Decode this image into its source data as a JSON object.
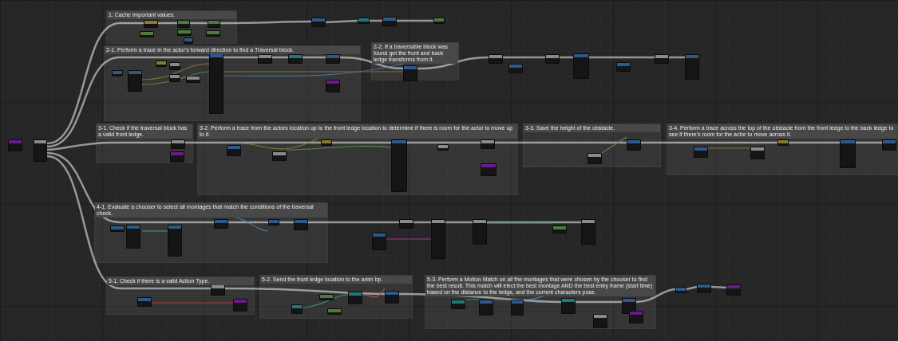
{
  "comments": [
    {
      "title": "1. Cache important values."
    },
    {
      "title": "2-1. Perform a trace in the actor's forward direction to find a Traversal block."
    },
    {
      "title": "2-2. If a traversable block was found get the front and back ledge transforms from it."
    },
    {
      "title": "3-1. Check if the traversal block has a valid front ledge."
    },
    {
      "title": "3-2. Perform a trace from the actors location up to the front ledge location to determine if there is room for the actor to move up to it."
    },
    {
      "title": "3-3. Save the height of the obstacle."
    },
    {
      "title": "3-4. Perform a trace across the top of the obstacle from the front ledge to the back ledge to see if there's room for the actor to move across it."
    },
    {
      "title": "4-1. Evaluate a chooser to select all montages that match the conditions of the traversal check."
    },
    {
      "title": "5-1. Check if there is a valid Action Type."
    },
    {
      "title": "5-2. Send the front ledge location to the anim bp."
    },
    {
      "title": "5-3. Perform a Motion Match on all the montages that were chosen by the chooser to find the best result. This match will elect the best montage AND the best entry frame (start time) based on the distance to the ledge, and the current characters pose."
    }
  ],
  "nodes": [
    {
      "color": "#6a1a8a"
    },
    {
      "color": "#8a8a8a"
    },
    {
      "color": "#8a7a30"
    },
    {
      "color": "#4e7a3c"
    },
    {
      "color": "#4e7a3c"
    },
    {
      "color": "#4e7a3c"
    },
    {
      "color": "#4e7a3c"
    },
    {
      "color": "#4e7a3c"
    },
    {
      "color": "#2d5a8a"
    },
    {
      "color": "#2d5a8a"
    },
    {
      "color": "#1e7a7a"
    },
    {
      "color": "#2d5a8a"
    },
    {
      "color": "#4e7a3c"
    },
    {
      "color": "#2d5a8a"
    },
    {
      "color": "#2d5a8a"
    },
    {
      "color": "#8a7a30"
    },
    {
      "color": "#8a8a8a"
    },
    {
      "color": "#8a8a8a"
    },
    {
      "color": "#8a8a8a"
    },
    {
      "color": "#2d5a8a"
    },
    {
      "color": "#8a8a8a"
    },
    {
      "color": "#1e7a7a"
    },
    {
      "color": "#2d5a8a"
    },
    {
      "color": "#6a1a8a"
    },
    {
      "color": "#2d5a8a"
    },
    {
      "color": "#8a8a8a"
    },
    {
      "color": "#2d5a8a"
    },
    {
      "color": "#8a8a8a"
    },
    {
      "color": "#2d5a8a"
    },
    {
      "color": "#2d5a8a"
    },
    {
      "color": "#8a8a8a"
    },
    {
      "color": "#2d5a8a"
    },
    {
      "color": "#8a8a8a"
    },
    {
      "color": "#6a1a8a"
    },
    {
      "color": "#2d5a8a"
    },
    {
      "color": "#8a8a8a"
    },
    {
      "color": "#8a7a30"
    },
    {
      "color": "#2d5a8a"
    },
    {
      "color": "#8a8a8a"
    },
    {
      "color": "#8a8a8a"
    },
    {
      "color": "#6a1a8a"
    },
    {
      "color": "#8a8a8a"
    },
    {
      "color": "#2d5a8a"
    },
    {
      "color": "#2d5a8a"
    },
    {
      "color": "#8a8a8a"
    },
    {
      "color": "#8a7a30"
    },
    {
      "color": "#2d5a8a"
    },
    {
      "color": "#2d5a8a"
    },
    {
      "color": "#2d5a8a"
    },
    {
      "color": "#2d5a8a"
    },
    {
      "color": "#2d5a8a"
    },
    {
      "color": "#2d5a8a"
    },
    {
      "color": "#2d5a8a"
    },
    {
      "color": "#2d5a8a"
    },
    {
      "color": "#2d5a8a"
    },
    {
      "color": "#8a8a8a"
    },
    {
      "color": "#8a8a8a"
    },
    {
      "color": "#8a8a8a"
    },
    {
      "color": "#4e7a3c"
    },
    {
      "color": "#8a8a8a"
    },
    {
      "color": "#2d5a8a"
    },
    {
      "color": "#8a8a8a"
    },
    {
      "color": "#6a1a8a"
    },
    {
      "color": "#1e7a7a"
    },
    {
      "color": "#4e7a3c"
    },
    {
      "color": "#4e7a3c"
    },
    {
      "color": "#1e7a7a"
    },
    {
      "color": "#2d5a8a"
    },
    {
      "color": "#1e7a7a"
    },
    {
      "color": "#2d5a8a"
    },
    {
      "color": "#2d5a8a"
    },
    {
      "color": "#1e7a7a"
    },
    {
      "color": "#8a8a8a"
    },
    {
      "color": "#2d5a8a"
    },
    {
      "color": "#6a1a8a"
    },
    {
      "color": "#2d5a8a"
    },
    {
      "color": "#2d5a8a"
    },
    {
      "color": "#6a1a8a"
    }
  ]
}
